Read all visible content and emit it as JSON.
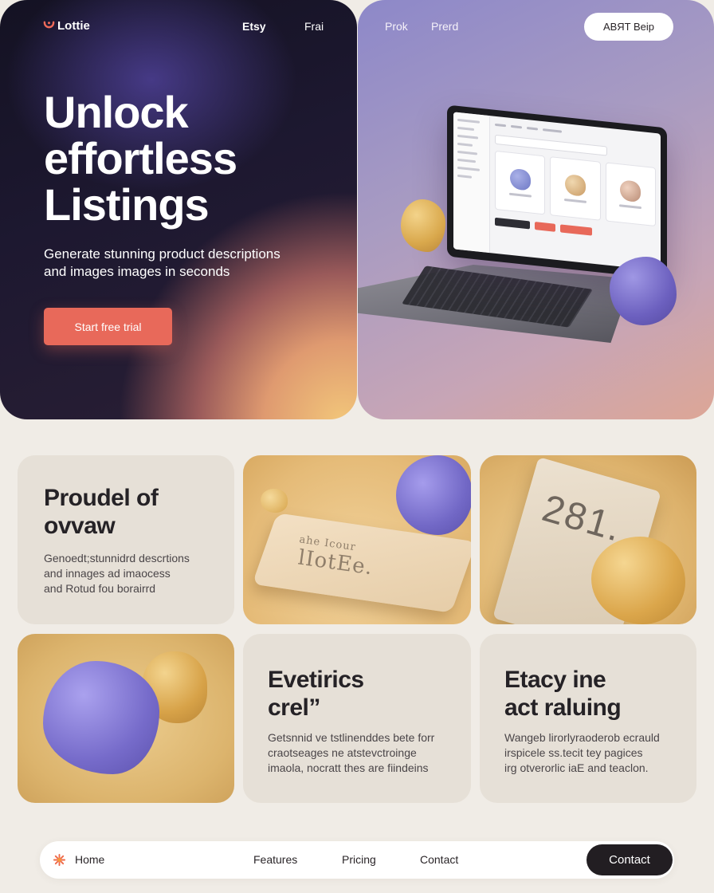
{
  "header": {
    "logo_text": "Lottie",
    "nav": [
      "Etsy",
      "Frai",
      "Prok",
      "Prerd"
    ],
    "pill_button": "ABЯT Beip"
  },
  "hero": {
    "headline": [
      "Unlock",
      "effortless",
      "Listings"
    ],
    "subtext": [
      "Generate stunning product descriptions",
      "and images images in seconds"
    ],
    "cta_label": "Start free trial"
  },
  "cards": {
    "c1": {
      "title": [
        "Proudel of",
        "ovvaw"
      ],
      "body": [
        "Genoedt;stunnidrd descrtions",
        "and innages ad imaocess",
        "and Rotud fou borairrd"
      ]
    },
    "c2": {
      "plate_text_top": "ahe Icour",
      "plate_text": "lIotEe."
    },
    "c3": {
      "tag_text": "281."
    },
    "c5": {
      "title": [
        "Evetirics",
        "crel”"
      ],
      "body": [
        "Getsnnid ve tstlinenddes bete forr",
        "craotseages ne atstevctroinge",
        "imaola, nocratt thes are fiindeins"
      ]
    },
    "c6": {
      "title": [
        "Etacy ine",
        "act raluing"
      ],
      "body": [
        "Wangeb lirorlyraoderob ecrauld",
        "irspicele ss.tecit tey pagices",
        "irg otverorlic iaE and teaclon."
      ]
    }
  },
  "bottom_nav": {
    "home": "Home",
    "features": "Features",
    "pricing": "Pricing",
    "contact_link": "Contact",
    "contact_button": "Contact"
  },
  "colors": {
    "accent_cta": "#e8695a",
    "dark_button": "#221e22",
    "blob_purple": "#766bca",
    "blob_yellow": "#dba64b"
  }
}
